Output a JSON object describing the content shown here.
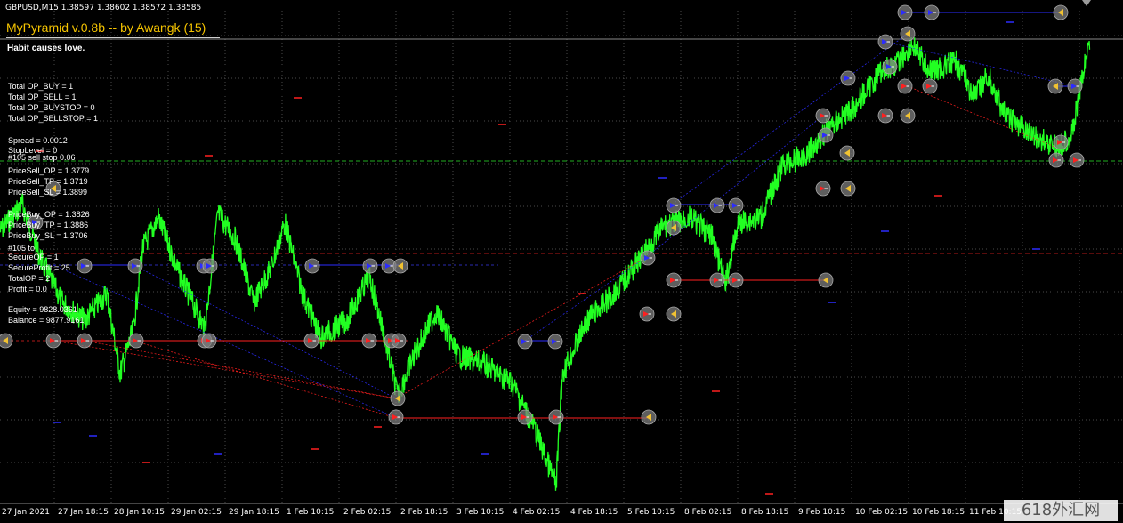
{
  "header": {
    "symbol_line": "GBPUSD,M15  1.38597 1.38602 1.38572 1.38585",
    "ea_title": "MyPyramid v.0.8b -- by Awangk (15)",
    "motto": "Habit causes love."
  },
  "info_panel": {
    "lines": [
      "Total OP_BUY = 1",
      "Total OP_SELL = 1",
      "Total OP_BUYSTOP = 0",
      "Total OP_SELLSTOP = 1",
      "Spread = 0.0012",
      "StopLevel = 0",
      "#105 sell stop 0.06",
      "PriceSell_OP = 1.3779",
      "PriceSell_TP = 1.3719",
      "PriceSell_SL = 1.3899",
      "PriceBuy_OP = 1.3826",
      "PriceBuy_TP = 1.3886",
      "PriceBuy_SL = 1.3706",
      "#105 to",
      "SecureOP = 1",
      "SecureProfit = 25",
      "TotalOP = 2",
      "Profit = 0.0",
      "Equity = 9828.0361",
      "Balance = 9877.9161"
    ]
  },
  "time_axis": {
    "labels": [
      "27 Jan 2021",
      "27 Jan 18:15",
      "28 Jan 10:15",
      "29 Jan 02:15",
      "29 Jan 18:15",
      "1 Feb 10:15",
      "2 Feb 02:15",
      "2 Feb 18:15",
      "3 Feb 10:15",
      "4 Feb 02:15",
      "4 Feb 18:15",
      "5 Feb 10:15",
      "8 Feb 02:15",
      "8 Feb 18:15",
      "9 Feb 10:15",
      "10 Feb 02:15",
      "10 Feb 18:15",
      "11 Feb 10:15"
    ]
  },
  "watermark": "618外汇网",
  "colors": {
    "background": "#000000",
    "price": "#22ff22",
    "grid": "#4a4a4a",
    "buy": "#2c2cff",
    "sell": "#ff2020",
    "ea_title": "#f5c400",
    "text": "#ffffff"
  },
  "icons": {
    "buy_order": "buy-arrow-icon",
    "sell_order": "sell-arrow-icon",
    "close_order": "close-marker-icon"
  }
}
